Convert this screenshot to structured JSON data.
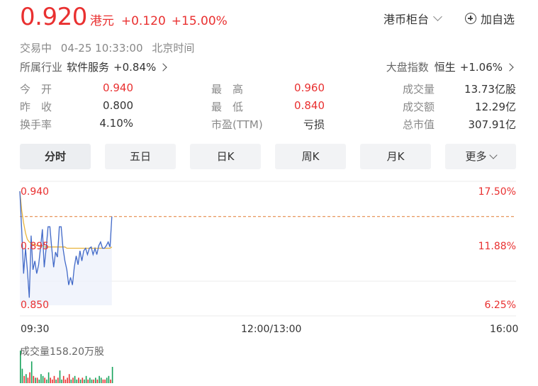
{
  "header": {
    "price": "0.920",
    "currency": "港元",
    "change": "+0.120",
    "change_pct": "+15.00%",
    "market_select": "港币柜台",
    "watchlist_label": "加自选"
  },
  "status": {
    "state": "交易中",
    "datetime": "04-25 10:33:00",
    "timezone": "北京时间"
  },
  "industry": {
    "label": "所属行业",
    "name": "软件服务",
    "pct": "+0.84%"
  },
  "index": {
    "label": "大盘指数",
    "name": "恒生",
    "pct": "+1.06%"
  },
  "stats": {
    "open_label": "今　开",
    "open_value": "0.940",
    "prev_close_label": "昨　收",
    "prev_close_value": "0.800",
    "turnover_rate_label": "换手率",
    "turnover_rate_value": "4.10%",
    "high_label": "最　高",
    "high_value": "0.960",
    "low_label": "最　低",
    "low_value": "0.840",
    "pe_label": "市盈(TTM)",
    "pe_value": "亏损",
    "volume_label": "成交量",
    "volume_value": "13.73亿股",
    "amount_label": "成交额",
    "amount_value": "12.29亿",
    "mktcap_label": "总市值",
    "mktcap_value": "307.91亿"
  },
  "tabs": [
    "分时",
    "五日",
    "日K",
    "周K",
    "月K",
    "更多"
  ],
  "colors": {
    "up": "#e93030",
    "down": "#15a25a",
    "price_line": "#4169c8",
    "avg_line": "#e8b33c",
    "ref_line": "#e07a30"
  },
  "chart_data": {
    "type": "line",
    "title": "",
    "y_left_ticks": [
      "0.940",
      "0.895",
      "0.850"
    ],
    "y_right_ticks": [
      "17.50%",
      "11.88%",
      "6.25%"
    ],
    "x_ticks": [
      "09:30",
      "12:00/13:00",
      "16:00"
    ],
    "ylim": [
      0.85,
      0.94
    ],
    "reference_price": 0.92,
    "volume_label": "成交量158.20万股",
    "series": [
      {
        "values": [
          0.94,
          0.91,
          0.875,
          0.895,
          0.878,
          0.856,
          0.905,
          0.878,
          0.885,
          0.875,
          0.882,
          0.895,
          0.91,
          0.88,
          0.895,
          0.912,
          0.912,
          0.895,
          0.88,
          0.892,
          0.888,
          0.912,
          0.912,
          0.895,
          0.885,
          0.878,
          0.866,
          0.872,
          0.866,
          0.88,
          0.889,
          0.882,
          0.893,
          0.885,
          0.893,
          0.895,
          0.89,
          0.895,
          0.896,
          0.89,
          0.895,
          0.89,
          0.897,
          0.9,
          0.895,
          0.895,
          0.897,
          0.9,
          0.896,
          0.92
        ]
      },
      {
        "values": [
          0.94,
          0.925,
          0.915,
          0.907,
          0.902,
          0.9,
          0.899,
          0.898,
          0.898,
          0.897,
          0.897,
          0.897,
          0.897,
          0.896,
          0.896,
          0.896,
          0.896,
          0.896,
          0.896,
          0.896,
          0.896,
          0.896,
          0.896,
          0.896,
          0.896,
          0.895,
          0.895,
          0.895,
          0.895,
          0.895,
          0.895,
          0.895,
          0.895,
          0.895,
          0.895,
          0.895,
          0.895,
          0.895,
          0.895,
          0.895,
          0.895,
          0.895,
          0.895,
          0.895,
          0.895,
          0.895,
          0.895,
          0.895,
          0.895,
          0.896
        ]
      }
    ],
    "volume_series": [
      {
        "v": 18,
        "up": true
      },
      {
        "v": 8,
        "up": true
      },
      {
        "v": 4,
        "up": false
      },
      {
        "v": 5,
        "up": true
      },
      {
        "v": 3,
        "up": false
      },
      {
        "v": 6,
        "up": false
      },
      {
        "v": 12,
        "up": true
      },
      {
        "v": 4,
        "up": false
      },
      {
        "v": 3,
        "up": true
      },
      {
        "v": 3,
        "up": false
      },
      {
        "v": 2,
        "up": true
      },
      {
        "v": 5,
        "up": true
      },
      {
        "v": 4,
        "up": true
      },
      {
        "v": 3,
        "up": false
      },
      {
        "v": 2,
        "up": true
      },
      {
        "v": 6,
        "up": true
      },
      {
        "v": 3,
        "up": false
      },
      {
        "v": 2,
        "up": false
      },
      {
        "v": 4,
        "up": false
      },
      {
        "v": 2,
        "up": true
      },
      {
        "v": 3,
        "up": false
      },
      {
        "v": 7,
        "up": true
      },
      {
        "v": 2,
        "up": true
      },
      {
        "v": 4,
        "up": false
      },
      {
        "v": 2,
        "up": false
      },
      {
        "v": 3,
        "up": false
      },
      {
        "v": 5,
        "up": false
      },
      {
        "v": 2,
        "up": true
      },
      {
        "v": 3,
        "up": false
      },
      {
        "v": 4,
        "up": true
      },
      {
        "v": 2,
        "up": true
      },
      {
        "v": 3,
        "up": false
      },
      {
        "v": 2,
        "up": true
      },
      {
        "v": 3,
        "up": false
      },
      {
        "v": 2,
        "up": true
      },
      {
        "v": 4,
        "up": true
      },
      {
        "v": 2,
        "up": false
      },
      {
        "v": 3,
        "up": true
      },
      {
        "v": 2,
        "up": true
      },
      {
        "v": 2,
        "up": false
      },
      {
        "v": 3,
        "up": true
      },
      {
        "v": 2,
        "up": false
      },
      {
        "v": 4,
        "up": true
      },
      {
        "v": 3,
        "up": true
      },
      {
        "v": 2,
        "up": false
      },
      {
        "v": 2,
        "up": false
      },
      {
        "v": 3,
        "up": true
      },
      {
        "v": 4,
        "up": true
      },
      {
        "v": 2,
        "up": false
      },
      {
        "v": 9,
        "up": true
      }
    ]
  }
}
